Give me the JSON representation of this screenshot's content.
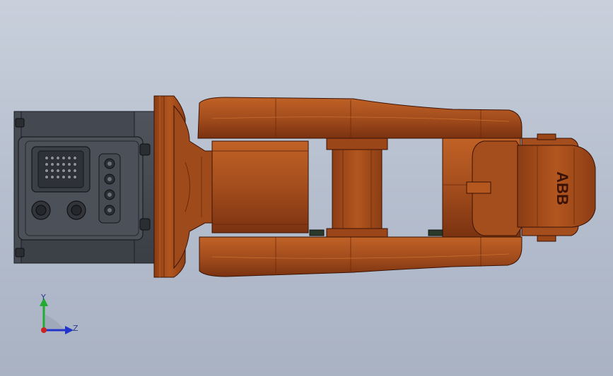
{
  "model": {
    "name": "robot-arm-top-view",
    "logo_text": "ABB",
    "colors": {
      "background_top": "#c9d0dc",
      "background_bottom": "#a9b2c3",
      "arm_orange": "#a44d1d",
      "arm_dark": "#6b2a0c",
      "base_dark": "#3a3e45",
      "base_plate": "#4c5058"
    }
  },
  "triad": {
    "y_label": "Y",
    "z_label": "Z",
    "y_color": "#22aa33",
    "z_color": "#2233cc",
    "origin_color": "#cc2222"
  }
}
